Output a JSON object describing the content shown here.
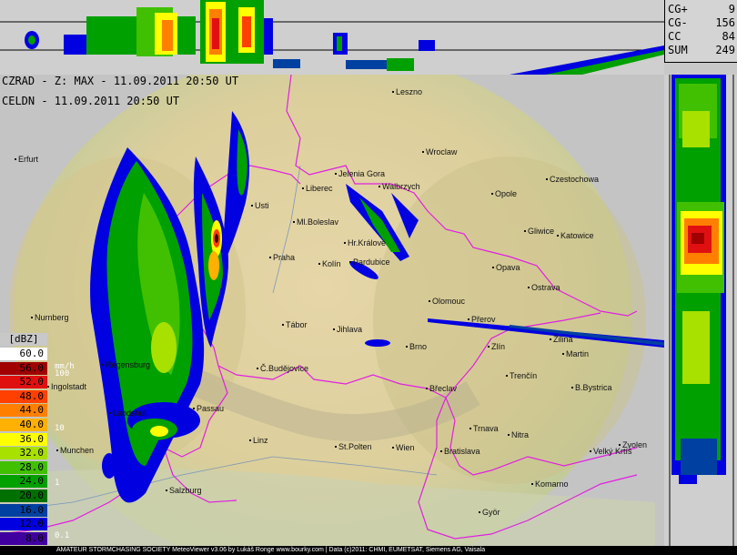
{
  "header": {
    "radar_line": "CZRAD - Z: MAX - 11.09.2011 20:50 UT",
    "lightning_line": "CELDN - 11.09.2011 20:50 UT"
  },
  "lightning_counts": [
    {
      "key": "CG+",
      "value": "9"
    },
    {
      "key": "CG-",
      "value": "156"
    },
    {
      "key": "CC",
      "value": "84"
    },
    {
      "key": "SUM",
      "value": "249"
    }
  ],
  "legend": {
    "unit": "[dBZ]",
    "levels": [
      {
        "label": "60.0",
        "color": "#ffffff",
        "text": "#000000"
      },
      {
        "label": "56.0",
        "color": "#a00000",
        "text": "#000000"
      },
      {
        "label": "52.0",
        "color": "#e01010",
        "text": "#000000"
      },
      {
        "label": "48.0",
        "color": "#ff4000",
        "text": "#000000"
      },
      {
        "label": "44.0",
        "color": "#ff8000",
        "text": "#000000"
      },
      {
        "label": "40.0",
        "color": "#ffb000",
        "text": "#000000"
      },
      {
        "label": "36.0",
        "color": "#ffff00",
        "text": "#000000"
      },
      {
        "label": "32.0",
        "color": "#a8e000",
        "text": "#000000"
      },
      {
        "label": "28.0",
        "color": "#40c000",
        "text": "#000000"
      },
      {
        "label": "24.0",
        "color": "#00a000",
        "text": "#000000"
      },
      {
        "label": "20.0",
        "color": "#007000",
        "text": "#000000"
      },
      {
        "label": "16.0",
        "color": "#0040a0",
        "text": "#000000"
      },
      {
        "label": "12.0",
        "color": "#0000e0",
        "text": "#000000"
      },
      {
        "label": "8.0",
        "color": "#4000a0",
        "text": "#000000"
      }
    ],
    "rain_rate_ticks": [
      "100",
      "10",
      "1",
      "0.1"
    ],
    "rain_rate_unit": "mm/h"
  },
  "cities": [
    {
      "name": "Leszno"
    },
    {
      "name": "Wroclaw"
    },
    {
      "name": "Erfurt"
    },
    {
      "name": "Jelenia Gora"
    },
    {
      "name": "Liberec"
    },
    {
      "name": "Walbrzych"
    },
    {
      "name": "Opole"
    },
    {
      "name": "Czestochowa"
    },
    {
      "name": "Usti"
    },
    {
      "name": "Ml.Boleslav"
    },
    {
      "name": "Gliwice"
    },
    {
      "name": "Katowice"
    },
    {
      "name": "Hr.Králové"
    },
    {
      "name": "Praha"
    },
    {
      "name": "Kolín"
    },
    {
      "name": "Pardubice"
    },
    {
      "name": "Opava"
    },
    {
      "name": "Ostrava"
    },
    {
      "name": "Olomouc"
    },
    {
      "name": "Nurnberg"
    },
    {
      "name": "Tábor"
    },
    {
      "name": "Jihlava"
    },
    {
      "name": "Přerov"
    },
    {
      "name": "Zlín"
    },
    {
      "name": "Brno"
    },
    {
      "name": "Žilina"
    },
    {
      "name": "Martin"
    },
    {
      "name": "Regensburg"
    },
    {
      "name": "Č.Budějovice"
    },
    {
      "name": "Ingolstadt"
    },
    {
      "name": "Břeclav"
    },
    {
      "name": "Trenčín"
    },
    {
      "name": "B.Bystrica"
    },
    {
      "name": "Passau"
    },
    {
      "name": "Landshut"
    },
    {
      "name": "Trnava"
    },
    {
      "name": "Nitra"
    },
    {
      "name": "Linz"
    },
    {
      "name": "Munchen"
    },
    {
      "name": "St.Polten"
    },
    {
      "name": "Wien"
    },
    {
      "name": "Bratislava"
    },
    {
      "name": "Zvolen"
    },
    {
      "name": "Velký Krtíš"
    },
    {
      "name": "Salzburg"
    },
    {
      "name": "Komarno"
    },
    {
      "name": "Györ"
    }
  ],
  "footer": {
    "credit": "AMATEUR STORMCHASING SOCIETY MeteoViewer v3.06 by Lukáš Ronge www.bourky.com | Data (c)2011: CHMI, EUMETSAT, Siemens AG, Vaisala"
  }
}
